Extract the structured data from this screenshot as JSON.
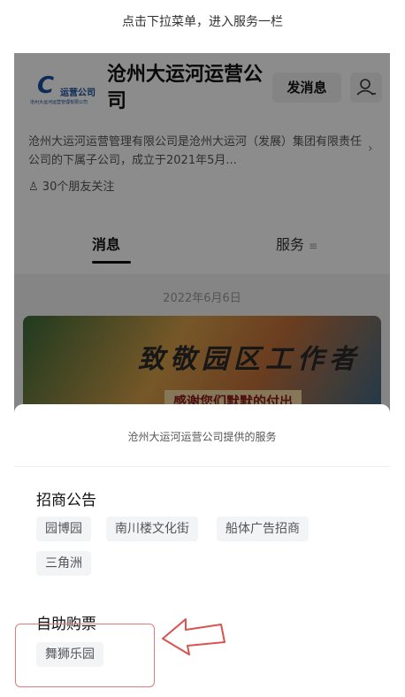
{
  "instruction": "点击下拉菜单，进入服务一栏",
  "account": {
    "logo_text": "运营公司",
    "logo_small_text": "沧州大运河运营管理有限公司",
    "name": "沧州大运河运营公司",
    "send_message_label": "发消息",
    "description": "沧州大运河运营管理有限公司是沧州大运河（发展）集团有限责任公司的下属子公司，成立于2021年5月...",
    "followers": "30个朋友关注"
  },
  "tabs": {
    "messages": "消息",
    "services": "服务"
  },
  "feed": {
    "date": "2022年6月6日",
    "banner_title": "致敬园区工作者",
    "banner_subtitle": "感谢您们默默的付出"
  },
  "sheet": {
    "title": "沧州大运河运营公司提供的服务",
    "sections": [
      {
        "title": "招商公告",
        "items": [
          "园博园",
          "南川楼文化街",
          "船体广告招商",
          "三角洲"
        ]
      },
      {
        "title": "自助购票",
        "items": [
          "舞狮乐园"
        ]
      }
    ]
  },
  "colors": {
    "brand_blue": "#1b4fa0",
    "highlight_red": "#e07b7b"
  }
}
